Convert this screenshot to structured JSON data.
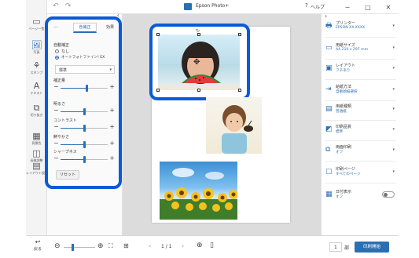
{
  "app": {
    "title": "Epson Photo+"
  },
  "titlebar": {
    "help_label": "ヘルプ",
    "undo": "↶",
    "redo": "↷"
  },
  "left_rail": {
    "items": [
      {
        "label": "ページ一覧"
      },
      {
        "label": "写真"
      },
      {
        "label": "スタンプ"
      },
      {
        "label": "テキスト"
      },
      {
        "label": "切り抜き"
      },
      {
        "label": "背景色"
      },
      {
        "label": "画像調整"
      },
      {
        "label": "レイアウト設定"
      }
    ]
  },
  "panel": {
    "tabs": [
      {
        "label": "色補正"
      },
      {
        "label": "効果"
      }
    ],
    "auto_label": "自動補正",
    "radio_none": "なし",
    "radio_auto": "オートフォトファイン! EX",
    "mode_value": "標準",
    "sliders": [
      {
        "label": "補正量",
        "value": 0.55
      },
      {
        "label": "明るさ",
        "value": 0.5
      },
      {
        "label": "コントラスト",
        "value": 0.5
      },
      {
        "label": "鮮やかさ",
        "value": 0.5
      },
      {
        "label": "シャープネス",
        "value": 0.5
      }
    ],
    "reset_label": "リセット"
  },
  "settings": [
    {
      "name": "プリンター",
      "value": "EPSON XX-XXXX"
    },
    {
      "name": "用紙サイズ",
      "value": "A4 210 x 297 mm"
    },
    {
      "name": "レイアウト",
      "value": "フチあり"
    },
    {
      "name": "給紙方法",
      "value": "自動給紙選択"
    },
    {
      "name": "用紙種類",
      "value": "普通紙"
    },
    {
      "name": "印刷品質",
      "value": "標準"
    },
    {
      "name": "両面印刷",
      "value": "オフ"
    },
    {
      "name": "印刷ページ",
      "value": "すべてのページ"
    },
    {
      "name": "日付表示",
      "value": "オフ"
    }
  ],
  "bottombar": {
    "back_label": "戻る",
    "page_indicator": "1 / 1",
    "copies_value": "1",
    "copies_unit": "部",
    "print_label": "印刷開始"
  },
  "colors": {
    "accent": "#0a5ad8",
    "brand": "#2b6fb3"
  }
}
